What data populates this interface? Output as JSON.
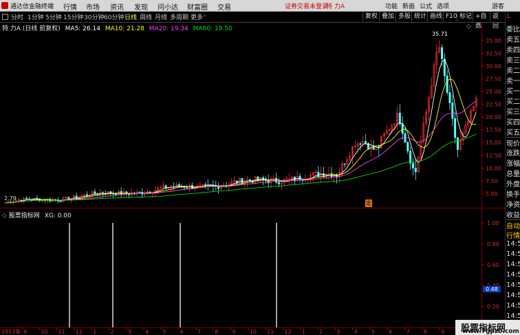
{
  "menubar": {
    "app_name": "通达信金融终端",
    "items": [
      "行情",
      "市场",
      "资讯",
      "发现",
      "问小达",
      "财富圈",
      "交易"
    ],
    "warning": "证券交易未登录",
    "stock": "特 力A",
    "right_items": [
      "功能",
      "新画",
      "公式",
      "选项",
      "游客"
    ]
  },
  "periods": {
    "items": [
      "分时",
      "1分钟",
      "5分钟",
      "15分钟",
      "30分钟",
      "60分钟",
      "日线",
      "周线",
      "月线",
      "多周期",
      "更多"
    ],
    "active": "日线",
    "tools": [
      "复权",
      "叠加",
      "多股",
      "统计",
      "画线",
      "F10",
      "标记",
      "+自选",
      "返回"
    ]
  },
  "main_chart": {
    "title": "特 力A (日线 前复权)",
    "ma": [
      {
        "label": "MA5: 26.14",
        "color": "#ffffff"
      },
      {
        "label": "MA10: 21.28",
        "color": "#ffff00"
      },
      {
        "label": "MA20: 19.34",
        "color": "#ff40ff"
      },
      {
        "label": "MA60: 19.50",
        "color": "#00e000"
      }
    ],
    "y_ticks": [
      "35.00",
      "32.50",
      "30.00",
      "27.50",
      "25.00",
      "22.50",
      "20.00",
      "17.50",
      "15.00",
      "12.50",
      "10.00",
      "7.50",
      "5.00"
    ],
    "y_min": 2.5,
    "y_max": 37.0,
    "low_label": "2.79",
    "high_label": "35.71",
    "marker": "定"
  },
  "indicator": {
    "title": "股票指标网",
    "value_label": "XG: 0.00",
    "y_ticks": [
      "1.00",
      "0.80",
      "0.60",
      "0.40",
      "0.20"
    ],
    "current_value": "0.48",
    "spikes_pct": [
      14,
      23,
      37,
      57
    ]
  },
  "xaxis": {
    "labels": [
      "2013年",
      "9",
      "10",
      "11",
      "12",
      "1",
      "2",
      "3",
      "4",
      "5",
      "6",
      "7",
      "8",
      "9",
      "10",
      "11",
      "12",
      "1",
      "2",
      "3",
      "4",
      "5",
      "6",
      "7",
      "8",
      "9"
    ]
  },
  "right_panel": {
    "top_label": "L",
    "rows": [
      "委比",
      "卖五",
      "卖四",
      "卖三",
      "卖二",
      "卖一",
      "买一",
      "买二",
      "买三",
      "买四",
      "买五",
      "现价",
      "涨跌",
      "涨幅",
      "总量",
      "外盘",
      "换手",
      "净资",
      "收益",
      "自动",
      "行情",
      "14:5",
      "14:5",
      "14:5",
      "14:5",
      "14:5",
      "14:5",
      "14:5",
      "14:5",
      "14:5"
    ]
  },
  "watermark": {
    "line1": "股票指标网",
    "line2": "www.7gpzb.com"
  }
}
